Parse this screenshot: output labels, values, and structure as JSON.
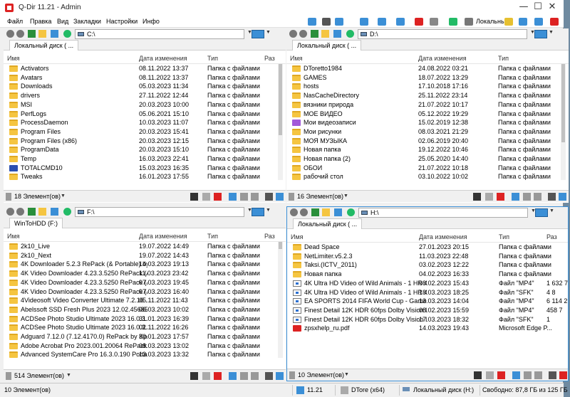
{
  "window": {
    "title": "Q-Dir 11.21 - Admin",
    "min": "—",
    "max": "☐",
    "close": "✕"
  },
  "menu": [
    "Файл",
    "Правка",
    "Вид",
    "Закладки",
    "Настройки",
    "Инфо"
  ],
  "toolbar_right": {
    "drive_label": "Локальны"
  },
  "columns": {
    "name": "Имя",
    "date": "Дата изменения",
    "type": "Тип",
    "size": "Раз"
  },
  "panes": {
    "tl": {
      "path": "C:\\",
      "tab": "Локальный диск ( ...",
      "status": "18 Элемент(ов)",
      "rows": [
        {
          "name": "Activators",
          "date": "08.11.2022 13:37",
          "type": "Папка с файлами",
          "size": "",
          "icon": "folder"
        },
        {
          "name": "Avatars",
          "date": "08.11.2022 13:37",
          "type": "Папка с файлами",
          "size": "",
          "icon": "folder"
        },
        {
          "name": "Downloads",
          "date": "05.03.2023 11:34",
          "type": "Папка с файлами",
          "size": "",
          "icon": "folder"
        },
        {
          "name": "drivers",
          "date": "27.11.2022 12:44",
          "type": "Папка с файлами",
          "size": "",
          "icon": "folder"
        },
        {
          "name": "MSI",
          "date": "20.03.2023 10:00",
          "type": "Папка с файлами",
          "size": "",
          "icon": "folder"
        },
        {
          "name": "PerfLogs",
          "date": "05.06.2021 15:10",
          "type": "Папка с файлами",
          "size": "",
          "icon": "folder"
        },
        {
          "name": "ProcessDaemon",
          "date": "10.03.2023 11:07",
          "type": "Папка с файлами",
          "size": "",
          "icon": "folder"
        },
        {
          "name": "Program Files",
          "date": "20.03.2023 15:41",
          "type": "Папка с файлами",
          "size": "",
          "icon": "folder"
        },
        {
          "name": "Program Files (x86)",
          "date": "20.03.2023 12:15",
          "type": "Папка с файлами",
          "size": "",
          "icon": "folder"
        },
        {
          "name": "ProgramData",
          "date": "20.03.2023 15:10",
          "type": "Папка с файлами",
          "size": "",
          "icon": "folder"
        },
        {
          "name": "Temp",
          "date": "16.03.2023 22:41",
          "type": "Папка с файлами",
          "size": "",
          "icon": "folder"
        },
        {
          "name": "TOTALCMD10",
          "date": "15.03.2023 16:35",
          "type": "Папка с файлами",
          "size": "",
          "icon": "exe"
        },
        {
          "name": "Tweaks",
          "date": "16.01.2023 17:55",
          "type": "Папка с файлами",
          "size": "",
          "icon": "folder"
        }
      ]
    },
    "tr": {
      "path": "D:\\",
      "tab": "Локальный диск ( ...",
      "status": "16 Элемент(ов)",
      "rows": [
        {
          "name": "DToretto1984",
          "date": "24.08.2022 03:21",
          "type": "Папка с файлами",
          "size": "",
          "icon": "folder"
        },
        {
          "name": "GAMES",
          "date": "18.07.2022 13:29",
          "type": "Папка с файлами",
          "size": "",
          "icon": "folder"
        },
        {
          "name": "hosts",
          "date": "17.10.2018 17:16",
          "type": "Папка с файлами",
          "size": "",
          "icon": "folder"
        },
        {
          "name": "NasCacheDirectory",
          "date": "25.11.2022 23:14",
          "type": "Папка с файлами",
          "size": "",
          "icon": "folder"
        },
        {
          "name": "вязники природа",
          "date": "21.07.2022 10:17",
          "type": "Папка с файлами",
          "size": "",
          "icon": "folder"
        },
        {
          "name": "МОЕ ВИДЕО",
          "date": "05.12.2022 19:29",
          "type": "Папка с файлами",
          "size": "",
          "icon": "folder"
        },
        {
          "name": "Мои видеозаписи",
          "date": "15.02.2019 12:38",
          "type": "Папка с файлами",
          "size": "",
          "icon": "vid"
        },
        {
          "name": "Мои рисунки",
          "date": "08.03.2021 21:29",
          "type": "Папка с файлами",
          "size": "",
          "icon": "folder"
        },
        {
          "name": "МОЯ МУЗЫКА",
          "date": "02.06.2019 20:40",
          "type": "Папка с файлами",
          "size": "",
          "icon": "folder"
        },
        {
          "name": "Новая папка",
          "date": "19.12.2022 10:46",
          "type": "Папка с файлами",
          "size": "",
          "icon": "folder"
        },
        {
          "name": "Новая папка (2)",
          "date": "25.05.2020 14:40",
          "type": "Папка с файлами",
          "size": "",
          "icon": "folder"
        },
        {
          "name": "ОБОИ",
          "date": "21.07.2022 10:18",
          "type": "Папка с файлами",
          "size": "",
          "icon": "folder"
        },
        {
          "name": "рабочий стол",
          "date": "03.10.2022 10:02",
          "type": "Папка с файлами",
          "size": "",
          "icon": "folder"
        }
      ]
    },
    "bl": {
      "path": "F:\\",
      "tab": "WinToHDD (F:)",
      "status": "514 Элемент(ов)",
      "rows": [
        {
          "name": "2k10_Live",
          "date": "19.07.2022 14:49",
          "type": "Папка с файлами",
          "size": "",
          "icon": "folder"
        },
        {
          "name": "2k10_Next",
          "date": "19.07.2022 14:43",
          "type": "Папка с файлами",
          "size": "",
          "icon": "folder"
        },
        {
          "name": "4K Downloader 5.2.3 RePack (& Portable) by ...",
          "date": "14.03.2023 19:13",
          "type": "Папка с файлами",
          "size": "",
          "icon": "folder"
        },
        {
          "name": "4K Video Downloader 4.23.3.5250 RePack (&...",
          "date": "11.03.2023 23:42",
          "type": "Папка с файлами",
          "size": "",
          "icon": "folder"
        },
        {
          "name": "4K Video Downloader 4.23.3.5250 RePack (&...",
          "date": "07.03.2023 19:45",
          "type": "Папка с файлами",
          "size": "",
          "icon": "folder"
        },
        {
          "name": "4K Video Downloader 4.23.3.5250 RePack (&...",
          "date": "07.03.2023 16:40",
          "type": "Папка с файлами",
          "size": "",
          "icon": "folder"
        },
        {
          "name": "4Videosoft Video Converter Ultimate 7.2.16 ...",
          "date": "05.11.2022 11:43",
          "type": "Папка с файлами",
          "size": "",
          "icon": "folder"
        },
        {
          "name": "Abelssoft SSD Fresh Plus 2023 12.02.45685 P...",
          "date": "06.03.2023 10:02",
          "type": "Папка с файлами",
          "size": "",
          "icon": "folder"
        },
        {
          "name": "ACDSee Photo Studio Ultimate 2023 16.0.3.3...",
          "date": "31.01.2023 16:39",
          "type": "Папка с файлами",
          "size": "",
          "icon": "folder"
        },
        {
          "name": "ACDSee Photo Studio Ultimate 2023 16.0.3.3...",
          "date": "02.11.2022 16:26",
          "type": "Папка с файлами",
          "size": "",
          "icon": "folder"
        },
        {
          "name": "Adguard 7.12.0 (7.12.4170.0) RePack by KpoJl...",
          "date": "30.01.2023 17:57",
          "type": "Папка с файлами",
          "size": "",
          "icon": "folder"
        },
        {
          "name": "Adobe Acrobat Pro 2023.001.20064 RePack b...",
          "date": "08.03.2023 13:02",
          "type": "Папка с файлами",
          "size": "",
          "icon": "folder"
        },
        {
          "name": "Advanced SystemCare Pro 16.3.0.190 Portab...",
          "date": "13.03.2023 13:32",
          "type": "Папка с файлами",
          "size": "",
          "icon": "folder"
        }
      ]
    },
    "br": {
      "path": "H:\\",
      "tab": "Локальный диск ( ...",
      "status": "10 Элемент(ов)",
      "rows": [
        {
          "name": "Dead Space",
          "date": "27.01.2023 20:15",
          "type": "Папка с файлами",
          "size": "",
          "icon": "folder"
        },
        {
          "name": "NetLimiter.v5.2.3",
          "date": "11.03.2023 22:48",
          "type": "Папка с файлами",
          "size": "",
          "icon": "folder"
        },
        {
          "name": "Taksi.(ICTV_2011)",
          "date": "03.02.2023 12:22",
          "type": "Папка с файлами",
          "size": "",
          "icon": "folder"
        },
        {
          "name": "Новая папка",
          "date": "04.02.2023 16:33",
          "type": "Папка с файлами",
          "size": "",
          "icon": "folder"
        },
        {
          "name": "4K Ultra HD Video of Wild Animals - 1 HR 4K...",
          "date": "08.02.2023 15:43",
          "type": "Файл \"MP4\"",
          "size": "1 632 7",
          "icon": "vfile"
        },
        {
          "name": "4K Ultra HD Video of Wild Animals - 1 HR 4K...",
          "date": "18.03.2023 18:25",
          "type": "Файл \"SFK\"",
          "size": "4 8",
          "icon": "vfile"
        },
        {
          "name": "EA SPORTS 2014 FIFA World Cup - Gameplay...",
          "date": "13.03.2023 14:04",
          "type": "Файл \"MP4\"",
          "size": "6 114 2",
          "icon": "vfile"
        },
        {
          "name": "Finest Detail 12K HDR 60fps  Dolby Vision I...",
          "date": "08.02.2023 15:59",
          "type": "Файл \"MP4\"",
          "size": "458 7",
          "icon": "vfile"
        },
        {
          "name": "Finest Detail 12K HDR 60fps  Dolby Vision I...",
          "date": "17.03.2023 18:32",
          "type": "Файл \"SFK\"",
          "size": "1",
          "icon": "vfile"
        },
        {
          "name": "zpsxhelp_ru.pdf",
          "date": "14.03.2023 19:43",
          "type": "Microsoft Edge P...",
          "size": "",
          "icon": "pdf"
        }
      ]
    }
  },
  "bottom": {
    "items": "10 Элемент(ов)",
    "version": "11.21",
    "user": "DTore (x64)",
    "drive": "Локальный диск (H:)",
    "free": "Свободно: 87,8 ГБ из 125 ГБ"
  },
  "colors": {
    "folder": "#f5c541",
    "accent": "#3b8fd6",
    "close_red": "#d22"
  }
}
